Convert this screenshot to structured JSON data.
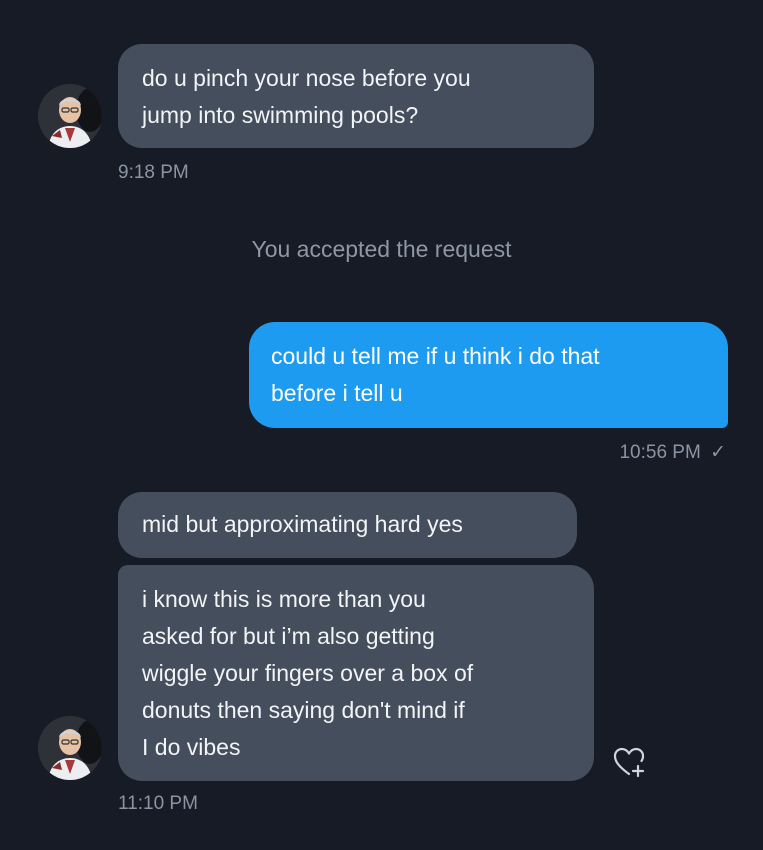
{
  "conversation": {
    "messages": [
      {
        "direction": "incoming",
        "lines": [
          "do u pinch your nose before you",
          "jump into swimming pools?"
        ],
        "time": "9:18 PM"
      },
      {
        "direction": "system",
        "text": "You accepted the request"
      },
      {
        "direction": "outgoing",
        "lines": [
          "could u tell me if u think i do that",
          "before i tell u"
        ],
        "time": "10:56 PM",
        "status_mark": "✓"
      },
      {
        "direction": "incoming",
        "lines": [
          "mid but approximating hard yes"
        ]
      },
      {
        "direction": "incoming",
        "lines": [
          "i know this is more than you",
          "asked for but i’m also getting",
          "wiggle your fingers over a box of",
          "donuts then saying don't mind if",
          "I do vibes"
        ],
        "time": "11:10 PM"
      }
    ]
  },
  "icons": {
    "avatar": "avatar-cartoon-man",
    "react": "heart-plus-icon",
    "read_receipt": "checkmark-icon"
  },
  "colors": {
    "background": "#161b26",
    "incoming_bubble": "#444e5c",
    "outgoing_bubble": "#1d9bf0",
    "meta_text": "#8a94a3"
  }
}
